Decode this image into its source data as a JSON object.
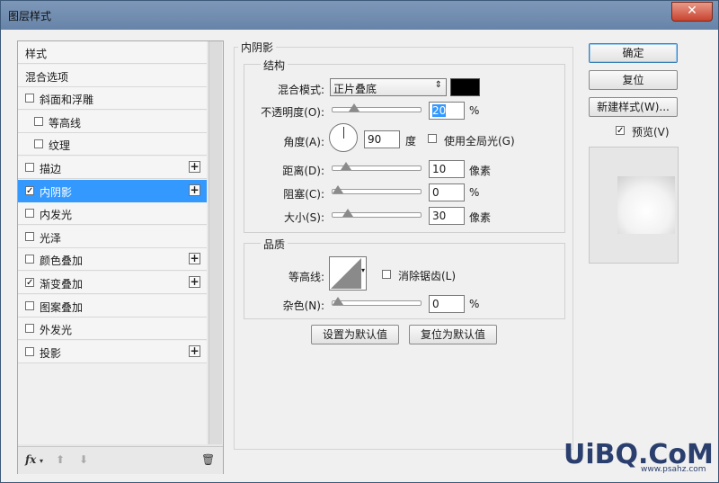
{
  "window": {
    "title": "图层样式",
    "close": "✕"
  },
  "styles_list": {
    "items": [
      {
        "label": "样式",
        "checkbox": false,
        "checked": false,
        "indent": false,
        "plus": false,
        "selected": false
      },
      {
        "label": "混合选项",
        "checkbox": false,
        "checked": false,
        "indent": false,
        "plus": false,
        "selected": false
      },
      {
        "label": "斜面和浮雕",
        "checkbox": true,
        "checked": false,
        "indent": false,
        "plus": false,
        "selected": false
      },
      {
        "label": "等高线",
        "checkbox": true,
        "checked": false,
        "indent": true,
        "plus": false,
        "selected": false
      },
      {
        "label": "纹理",
        "checkbox": true,
        "checked": false,
        "indent": true,
        "plus": false,
        "selected": false
      },
      {
        "label": "描边",
        "checkbox": true,
        "checked": false,
        "indent": false,
        "plus": true,
        "selected": false
      },
      {
        "label": "内阴影",
        "checkbox": true,
        "checked": true,
        "indent": false,
        "plus": true,
        "selected": true
      },
      {
        "label": "内发光",
        "checkbox": true,
        "checked": false,
        "indent": false,
        "plus": false,
        "selected": false
      },
      {
        "label": "光泽",
        "checkbox": true,
        "checked": false,
        "indent": false,
        "plus": false,
        "selected": false
      },
      {
        "label": "颜色叠加",
        "checkbox": true,
        "checked": false,
        "indent": false,
        "plus": true,
        "selected": false
      },
      {
        "label": "渐变叠加",
        "checkbox": true,
        "checked": true,
        "indent": false,
        "plus": true,
        "selected": false
      },
      {
        "label": "图案叠加",
        "checkbox": true,
        "checked": false,
        "indent": false,
        "plus": false,
        "selected": false
      },
      {
        "label": "外发光",
        "checkbox": true,
        "checked": false,
        "indent": false,
        "plus": false,
        "selected": false
      },
      {
        "label": "投影",
        "checkbox": true,
        "checked": false,
        "indent": false,
        "plus": true,
        "selected": false
      }
    ],
    "bottom": {
      "fx": "fx",
      "trash": "🗑"
    }
  },
  "inner_shadow": {
    "section_title": "内阴影",
    "structure": {
      "title": "结构",
      "blend_mode_label": "混合模式:",
      "blend_mode_value": "正片叠底",
      "color": "#000000",
      "opacity_label": "不透明度(O):",
      "opacity_value": "20",
      "opacity_unit": "%",
      "opacity_level": 20,
      "angle_label": "角度(A):",
      "angle_value": "90",
      "angle_unit": "度",
      "global_light_label": "使用全局光(G)",
      "global_light_checked": false,
      "distance_label": "距离(D):",
      "distance_value": "10",
      "distance_unit": "像素",
      "distance_level": 10,
      "choke_label": "阻塞(C):",
      "choke_value": "0",
      "choke_unit": "%",
      "choke_level": 0,
      "size_label": "大小(S):",
      "size_value": "30",
      "size_unit": "像素",
      "size_level": 12
    },
    "quality": {
      "title": "品质",
      "contour_label": "等高线:",
      "antialias_label": "消除锯齿(L)",
      "antialias_checked": false,
      "noise_label": "杂色(N):",
      "noise_value": "0",
      "noise_unit": "%",
      "noise_level": 0
    },
    "make_default": "设置为默认值",
    "reset_default": "复位为默认值"
  },
  "actions": {
    "ok": "确定",
    "reset": "复位",
    "new_style": "新建样式(W)...",
    "preview_label": "预览(V)",
    "preview_checked": true
  },
  "watermark": {
    "text": "UiBQ.CoM",
    "sub": "www.psahz.com"
  }
}
